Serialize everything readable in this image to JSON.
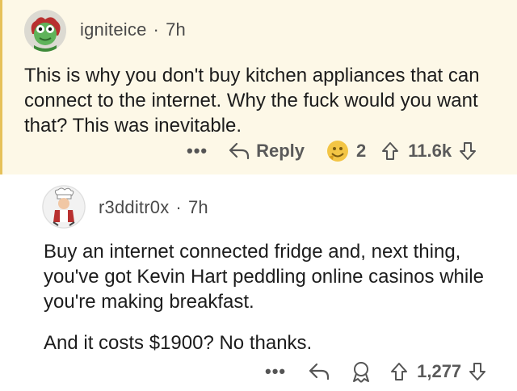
{
  "comment1": {
    "username": "igniteice",
    "separator": "·",
    "time": "7h",
    "text": "This is why you don't buy kitchen appliances that can connect to the internet. Why the fuck would you want that? This was inevitable.",
    "more_label": "•••",
    "reply_label": "Reply",
    "award_count": "2",
    "score": "11.6k",
    "icons": [
      "avatar-frog",
      "more-icon",
      "reply-icon",
      "award-icon",
      "upvote-icon",
      "downvote-icon"
    ],
    "colors": {
      "background": "#fdf8e7",
      "accent_border": "#e6c15a"
    }
  },
  "comment2": {
    "username": "r3dditr0x",
    "separator": "·",
    "time": "7h",
    "paragraphs": [
      "Buy an internet connected fridge and, next thing, you've got Kevin Hart peddling online casinos while you're making breakfast.",
      "And it costs $1900? No thanks."
    ],
    "more_label": "•••",
    "score": "1,277",
    "icons": [
      "avatar-chef",
      "more-icon",
      "reply-icon",
      "award-icon",
      "upvote-icon",
      "downvote-icon"
    ]
  }
}
